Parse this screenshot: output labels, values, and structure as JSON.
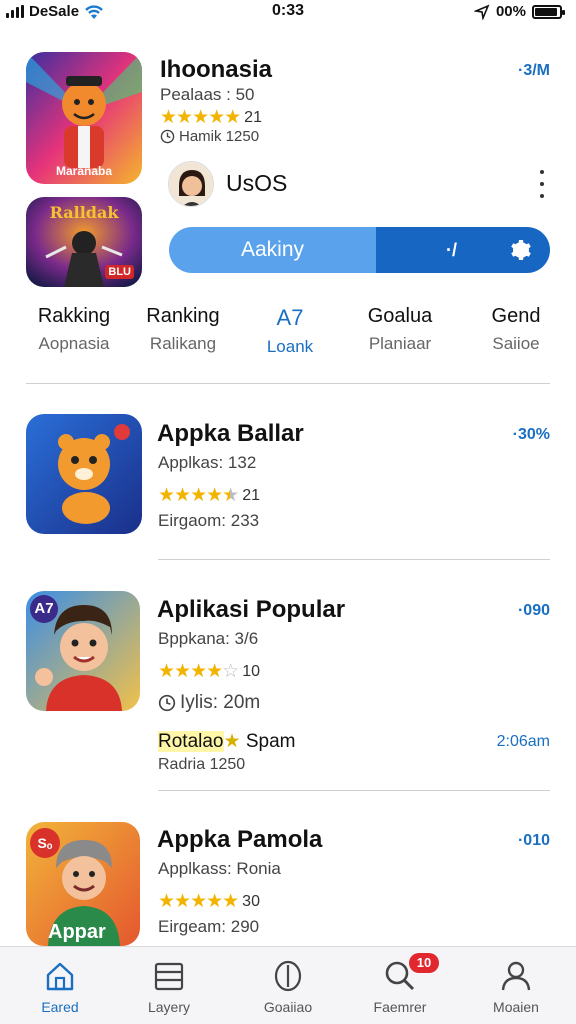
{
  "status_bar": {
    "carrier": "DeSale",
    "time": "0:33",
    "battery": "00%",
    "battery_level": 0.9
  },
  "featured": {
    "title": "Ihoonasia",
    "subtitle": "Pealaas : 50",
    "rating_count": "21",
    "rating_stars": 5,
    "meta": "Hamik 1250",
    "price": "·3/M",
    "icon1_caption": "Maranaba",
    "icon2_caption": "Ralldak",
    "icon2_sub": "BLU"
  },
  "profile": {
    "name": "UsOS"
  },
  "pill": {
    "left_label": "Aakiny",
    "right_label": "·/"
  },
  "tabs": [
    {
      "label": "Rakking",
      "sub": "Aopnasia"
    },
    {
      "label": "Ranking",
      "sub": "Ralikang"
    },
    {
      "label": "A7",
      "sub": "Loank"
    },
    {
      "label": "Goalua",
      "sub": "Planiaar"
    },
    {
      "label": "Gend",
      "sub": "Saiioe"
    }
  ],
  "apps": [
    {
      "title": "Appka Ballar",
      "subtitle": "Applkas: 132",
      "rating_count": "21",
      "rating_stars": 4.5,
      "meta": "Eirgaom: 233",
      "price": "·30%"
    },
    {
      "title": "Aplikasi Popular",
      "subtitle": "Bppkana: 3/6",
      "rating_count": "10",
      "rating_stars": 4,
      "meta": "Iylis: 20m",
      "price": "·090",
      "badge": "A7"
    },
    {
      "title": "Appka Pamola",
      "subtitle": "Applkass: Ronia",
      "rating_count": "30",
      "rating_stars": 5,
      "meta": "Eirgeam: 290",
      "price": "·010",
      "icon_caption": "Appar",
      "icon_tag": "Sₒ"
    }
  ],
  "promo": {
    "label_a": "Rotalao",
    "label_b": "Spam",
    "time": "2:06am",
    "sub": "Radria 1250"
  },
  "bottom_nav": [
    {
      "label": "Eared",
      "icon": "home-icon"
    },
    {
      "label": "Layery",
      "icon": "layers-icon"
    },
    {
      "label": "Goaiiao",
      "icon": "shield-icon"
    },
    {
      "label": "Faemrer",
      "icon": "search-icon",
      "badge": "10"
    },
    {
      "label": "Moaien",
      "icon": "user-icon"
    }
  ],
  "colors": {
    "accent": "#1a6fc2",
    "pill_left": "#5aa3ec",
    "pill_right": "#1766c2",
    "star": "#f3b400",
    "badge": "#e0282e"
  }
}
